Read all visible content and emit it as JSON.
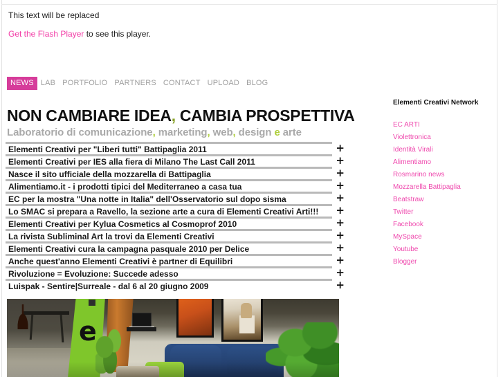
{
  "flash": {
    "replaced_text": "This text will be replaced",
    "get_player_link": "Get the Flash Player",
    "get_player_suffix": " to see this player."
  },
  "nav": {
    "items": [
      {
        "label": "NEWS",
        "active": true
      },
      {
        "label": "LAB",
        "active": false
      },
      {
        "label": "PORTFOLIO",
        "active": false
      },
      {
        "label": "PARTNERS",
        "active": false
      },
      {
        "label": "CONTACT",
        "active": false
      },
      {
        "label": "UPLOAD",
        "active": false
      },
      {
        "label": "BLOG",
        "active": false
      }
    ],
    "active_color": "#d63c9a"
  },
  "headline": {
    "part1": "NON CAMBIARE IDEA",
    "comma": ",",
    "part2": " CAMBIA PROSPETTIVA"
  },
  "subhead": {
    "part1": "Laboratorio di comunicazione",
    "comma1": ",",
    "part2": " marketing",
    "comma2": ",",
    "part3": " web",
    "comma3": ",",
    "part4": " design ",
    "e": "e",
    "part5": " arte"
  },
  "news": {
    "expand_symbol": "+",
    "items": [
      "Elementi Creativi per \"Liberi tutti\" Battipaglia 2011",
      "Elementi Creativi per IES alla fiera di Milano The Last Call 2011",
      "Nasce il sito ufficiale della mozzarella di Battipaglia",
      "Alimentiamo.it - i prodotti tipici del Mediterraneo a casa tua",
      "EC per la mostra \"Una notte in Italia\" dell'Osservatorio sul dopo sisma",
      "Lo SMAC si prepara a Ravello, la sezione arte a cura di Elementi Creativi Arti!!!",
      "Elementi Creativi per Kylua Cosmetics al Cosmoprof 2010",
      "La rivista Subliminal Art la trovi da Elementi Creativi",
      "Elementi Creativi cura la campagna pasquale 2010 per Delice",
      "Anche quest'anno Elementi Creativi è partner di Equilibri",
      "Rivoluzione = Evoluzione: Succede adesso",
      "Luispak - Sentire|Surreale - dal 6 al 20 giugno 2009"
    ]
  },
  "sidebar": {
    "title": "Elementi Creativi Network",
    "link_color": "#ef4aae",
    "links": [
      "EC ARTI",
      "Violettronica",
      "Identità Virali",
      "Alimentiamo",
      "Rosmarino news",
      "Mozzarella Battipaglia",
      "Beatstraw",
      "Twitter",
      "Facebook",
      "MySpace",
      "Youtube",
      "Blogger"
    ]
  },
  "photo": {
    "alt": "Interno dello studio Elementi Creativi: pannello verde con lettera e, portatile su mensola, poster alle pareti, divano blu e piante"
  }
}
